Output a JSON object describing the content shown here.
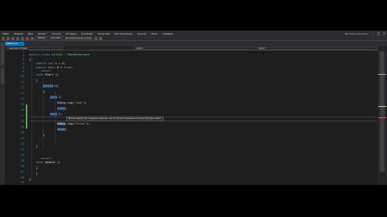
{
  "menu": {
    "items": [
      "Файл",
      "Правка",
      "Вид",
      "Проект",
      "Сборка",
      "Отладка",
      "Команда",
      "Средства",
      "Тестирование",
      "Анализ",
      "Окно",
      "Справка"
    ],
    "right_text": "Ярт Максимилиан"
  },
  "toolbar": {
    "config": "Debug",
    "platform": "Any CPU",
    "attach_label": "▶ Подключение к Unity"
  },
  "tabs": {
    "active": "Attack.cs"
  },
  "navbar": {
    "project": "Assembly-CSharp",
    "class": "Attack",
    "member": "Start()"
  },
  "gutter": {
    "lines": [
      "1",
      "2",
      "3",
      "4",
      "5",
      "6",
      "7",
      "8",
      "9",
      "10",
      "11",
      "12",
      "13",
      "14",
      "15",
      "16",
      "17",
      "18",
      "19",
      "20",
      "21",
      "22",
      "23",
      "24",
      "25",
      "26",
      "27",
      "28",
      "29",
      "30",
      "31"
    ]
  },
  "code": {
    "l1": "",
    "l2": "public class Attack : MonoBehaviour",
    "l3": "{",
    "l4a": "    public ",
    "l4b": "int",
    "l4c": " i = ",
    "l4d": "0",
    "l4e": ";",
    "l5a": "    public ",
    "l5b": "bool",
    "l5c": " b = ",
    "l5d": "true",
    "l5e": ";",
    "ref1": "Ссылок: 0",
    "l6a": "    void ",
    "l6b": "Start",
    "l6c": " ()",
    "l7": "    {",
    "l8a": "        ",
    "l8b": "switch",
    "l8c": "(i)",
    "l9": "        {",
    "l10a": "            ",
    "l10b": "case",
    "l10c": " 1:",
    "l11a": "                Debug.Log(",
    "l11b": "\"One\"",
    "l11c": ");",
    "l12a": "                ",
    "l12b": "break",
    "l12c": ";",
    "l13a": "            ",
    "l13b": "case",
    "l13c": " 1:",
    "l15a": "                ",
    "l15b": "Debug",
    "l15c": ".Log(",
    "l15d": "\"Error\"",
    "l15e": ");",
    "l16a": "                ",
    "l16b": "break",
    "l16c": ";",
    "l17": "        }",
    "l18": "",
    "l19": "    }",
    "ref2": "Ссылок: 0",
    "l21a": "    void ",
    "l21b": "Update",
    "l21c": " ()",
    "l22": "    {",
    "l23": "",
    "l24": "    }",
    "l25": "}"
  },
  "tooltip": {
    "text": "Метка вариантов 1 идущего дальше, так встречается ранее в этой инструкции switch"
  },
  "colors": {
    "accent": "#007acc",
    "keyword": "#569cd6",
    "type": "#4ec9b0",
    "string": "#d69d85",
    "background": "#1e1e1e"
  }
}
